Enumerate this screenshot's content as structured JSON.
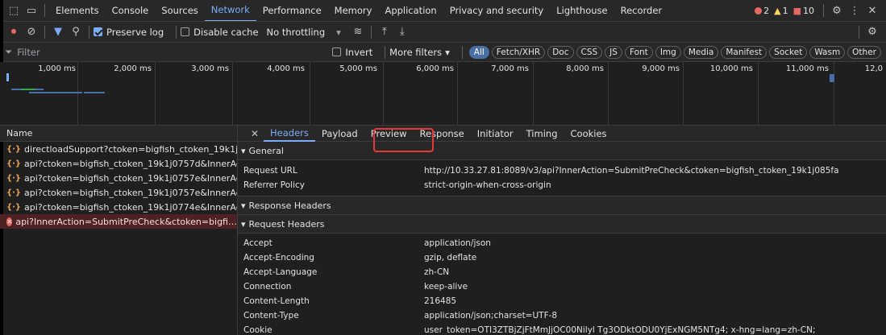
{
  "tabs": [
    "Elements",
    "Console",
    "Sources",
    "Network",
    "Performance",
    "Memory",
    "Application",
    "Privacy and security",
    "Lighthouse",
    "Recorder"
  ],
  "active_tab": "Network",
  "counts": {
    "errors": "2",
    "warnings": "1",
    "info": "10"
  },
  "toolbar": {
    "preserve_log": "Preserve log",
    "disable_cache": "Disable cache",
    "throttle": "No throttling"
  },
  "filter": {
    "placeholder": "Filter",
    "invert": "Invert",
    "more": "More filters",
    "types": [
      "All",
      "Fetch/XHR",
      "Doc",
      "CSS",
      "JS",
      "Font",
      "Img",
      "Media",
      "Manifest",
      "Socket",
      "Wasm",
      "Other"
    ]
  },
  "timeline": {
    "ticks": [
      "1,000 ms",
      "2,000 ms",
      "3,000 ms",
      "4,000 ms",
      "5,000 ms",
      "6,000 ms",
      "7,000 ms",
      "8,000 ms",
      "9,000 ms",
      "10,000 ms",
      "11,000 ms",
      "12,0"
    ]
  },
  "requests": {
    "header": "Name",
    "rows": [
      "directloadSupport?ctoken=bigfish_ctoken_19k1j…",
      "api?ctoken=bigfish_ctoken_19k1j0757d&InnerAc…",
      "api?ctoken=bigfish_ctoken_19k1j0757e&InnerAc…",
      "api?ctoken=bigfish_ctoken_19k1j0757e&InnerAc…",
      "api?ctoken=bigfish_ctoken_19k1j0774e&InnerAc…",
      "api?InnerAction=SubmitPreCheck&ctoken=bigfi…"
    ]
  },
  "detail_tabs": [
    "Headers",
    "Payload",
    "Preview",
    "Response",
    "Initiator",
    "Timing",
    "Cookies"
  ],
  "general": {
    "title": "General",
    "rows": [
      {
        "k": "Request URL",
        "v": "http://10.33.27.81:8089/v3/api?InnerAction=SubmitPreCheck&ctoken=bigfish_ctoken_19k1j085fa"
      },
      {
        "k": "Referrer Policy",
        "v": "strict-origin-when-cross-origin"
      }
    ]
  },
  "response_headers": {
    "title": "Response Headers"
  },
  "request_headers": {
    "title": "Request Headers",
    "rows": [
      {
        "k": "Accept",
        "v": "application/json"
      },
      {
        "k": "Accept-Encoding",
        "v": "gzip, deflate"
      },
      {
        "k": "Accept-Language",
        "v": "zh-CN"
      },
      {
        "k": "Connection",
        "v": "keep-alive"
      },
      {
        "k": "Content-Length",
        "v": "216485"
      },
      {
        "k": "Content-Type",
        "v": "application/json;charset=UTF-8"
      },
      {
        "k": "Cookie",
        "v": "user_token=OTI3ZTBjZjFtMmJjOC00Nilyl Tg3ODktODU0YjExNGM5NTg4; x-hng=lang=zh-CN;"
      }
    ]
  }
}
